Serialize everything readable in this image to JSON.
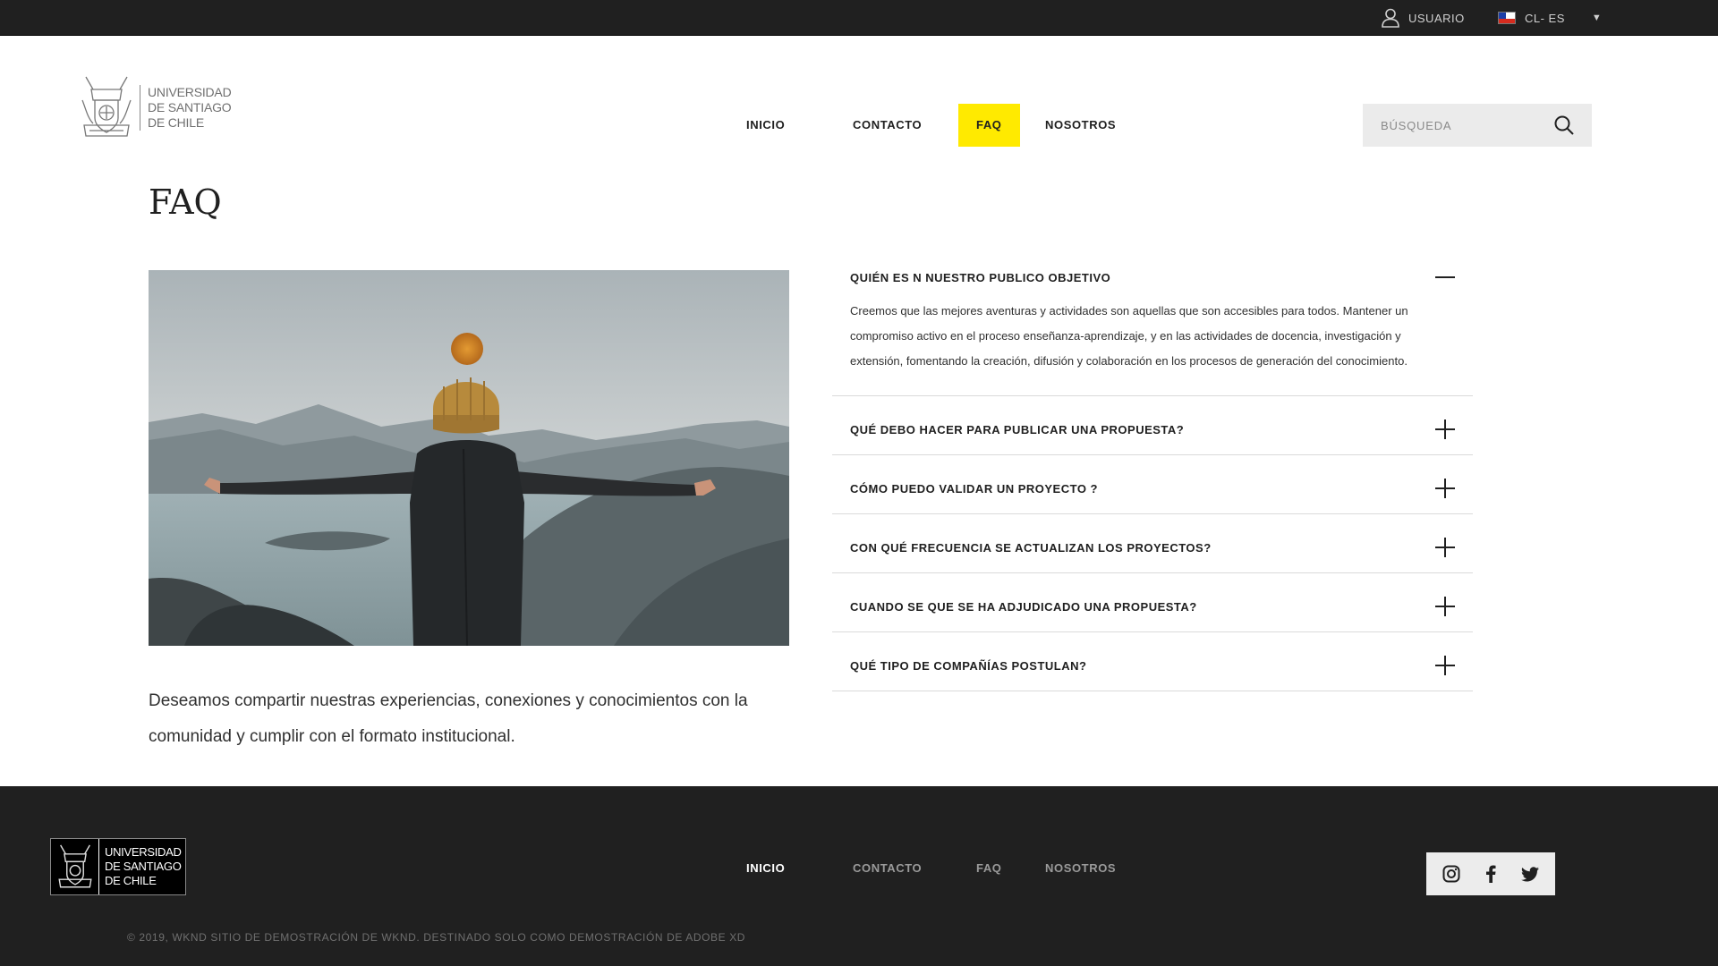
{
  "topbar": {
    "user_label": "USUARIO",
    "lang_label": "CL- ES",
    "lang_caret": "▼"
  },
  "header": {
    "logo_lines": [
      "UNIVERSIDAD",
      "DE SANTIAGO",
      "DE CHILE"
    ],
    "nav": [
      {
        "label": "INICIO",
        "active": false
      },
      {
        "label": "CONTACTO",
        "active": false
      },
      {
        "label": "FAQ",
        "active": true
      },
      {
        "label": "NOSOTROS",
        "active": false
      }
    ],
    "search": {
      "placeholder": "BÚSQUEDA",
      "value": ""
    },
    "accent_color": "#ffea00"
  },
  "main": {
    "title": "FAQ",
    "intro": "Deseamos compartir nuestras experiencias, conexiones y conocimientos con la comunidad y cumplir con el formato institucional.",
    "faq": [
      {
        "question": "QUIÉN ES N NUESTRO PUBLICO OBJETIVO",
        "expanded": true,
        "answer": "Creemos que las mejores aventuras y actividades son aquellas que son accesibles para todos. Mantener un compromiso activo en el proceso enseñanza-aprendizaje, y en las actividades de docencia, investigación y extensión, fomentando la creación, difusión y colaboración en los procesos de generación del conocimiento."
      },
      {
        "question": "QUÉ DEBO HACER PARA PUBLICAR UNA PROPUESTA?",
        "expanded": false
      },
      {
        "question": "CÓMO PUEDO VALIDAR UN PROYECTO ?",
        "expanded": false
      },
      {
        "question": "CON QUÉ FRECUENCIA SE ACTUALIZAN LOS PROYECTOS?",
        "expanded": false
      },
      {
        "question": "CUANDO SE QUE SE HA ADJUDICADO UNA PROPUESTA?",
        "expanded": false
      },
      {
        "question": "QUÉ TIPO DE COMPAÑÍAS POSTULAN?",
        "expanded": false
      }
    ]
  },
  "footer": {
    "logo_lines": [
      "UNIVERSIDAD",
      "DE SANTIAGO",
      "DE CHILE"
    ],
    "nav": [
      {
        "label": "INICIO",
        "active": true
      },
      {
        "label": "CONTACTO",
        "active": false
      },
      {
        "label": "FAQ",
        "active": false
      },
      {
        "label": "NOSOTROS",
        "active": false
      }
    ],
    "social": [
      "instagram-icon",
      "facebook-icon",
      "twitter-icon"
    ],
    "copyright": "© 2019, WKND SITIO DE DEMOSTRACIÓN DE WKND. DESTINADO SOLO COMO DEMOSTRACIÓN DE ADOBE XD"
  }
}
